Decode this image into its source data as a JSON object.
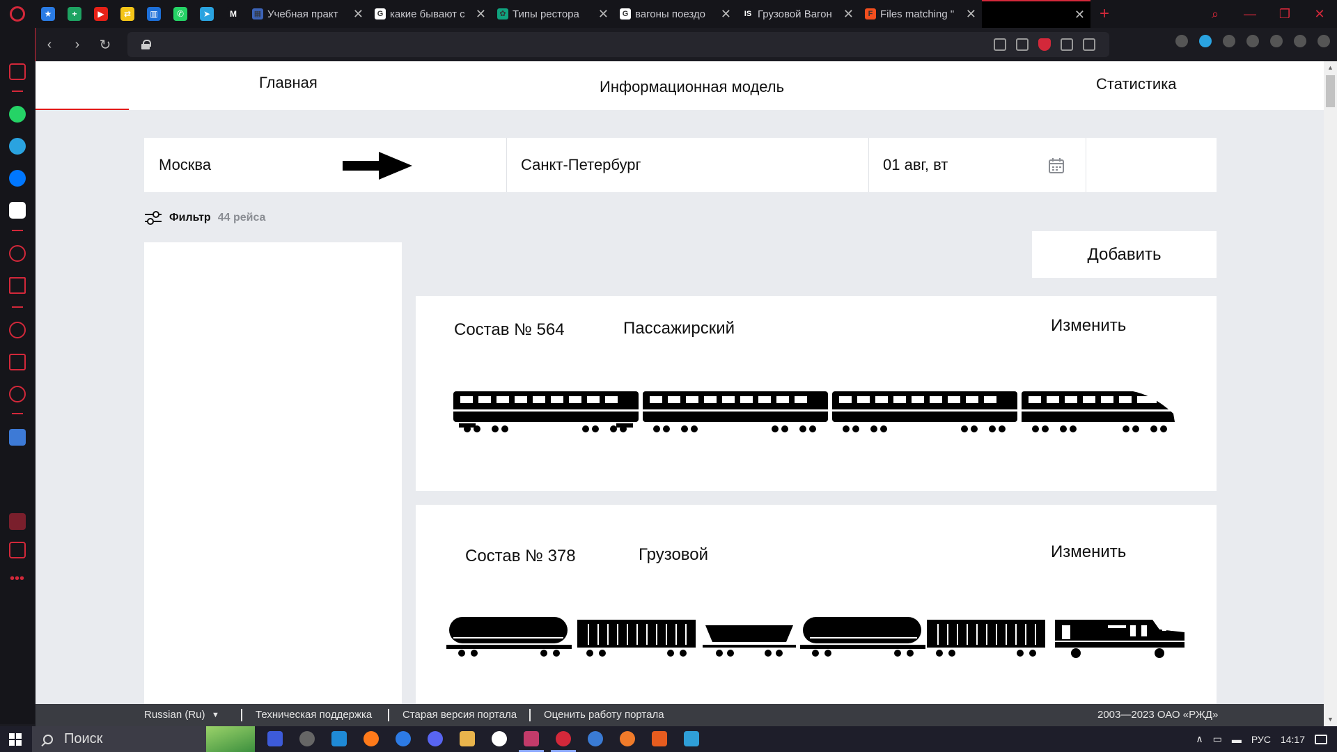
{
  "browser": {
    "tabs": [
      {
        "title": "Учебная практ",
        "favicon": "grid-icon",
        "color": "#3c63b7",
        "letter": "▦"
      },
      {
        "title": "какие бывают с",
        "favicon": "google-icon",
        "color": "#ffffff",
        "letter": "G"
      },
      {
        "title": "Типы рестора",
        "favicon": "chatgpt-icon",
        "color": "#10a37f",
        "letter": "✿"
      },
      {
        "title": "вагоны поездо",
        "favicon": "google-icon",
        "color": "#ffffff",
        "letter": "G"
      },
      {
        "title": "Грузовой Вагон",
        "favicon": "is-icon",
        "color": "#15151a",
        "letter": "IS"
      },
      {
        "title": "Files matching \"",
        "favicon": "figma-icon",
        "color": "#f24e1e",
        "letter": "F"
      },
      {
        "title": "",
        "favicon": "",
        "color": "#000000",
        "letter": ""
      }
    ],
    "pinned": [
      {
        "name": "aliexpress-icon",
        "color": "#2a7be4",
        "glyph": "★"
      },
      {
        "name": "sheets-icon",
        "color": "#1ea362",
        "glyph": "+"
      },
      {
        "name": "youtube-icon",
        "color": "#e62117",
        "glyph": "▶"
      },
      {
        "name": "swap-icon",
        "color": "#f5c518",
        "glyph": "⇄"
      },
      {
        "name": "trello-icon",
        "color": "#1d6fd8",
        "glyph": "▥"
      },
      {
        "name": "whatsapp-icon",
        "color": "#25d366",
        "glyph": "✆"
      },
      {
        "name": "telegram-icon",
        "color": "#2aa3e0",
        "glyph": "➤"
      },
      {
        "name": "gmail-icon",
        "color": "#15151a",
        "glyph": "M"
      }
    ]
  },
  "nav": {
    "home": "Главная",
    "model": "Информационная модель",
    "stats": "Статистика"
  },
  "route": {
    "from": "Москва",
    "to": "Санкт-Петербург",
    "date": "01 авг, вт"
  },
  "filter": {
    "label": "Фильтр",
    "count": "44 рейса"
  },
  "add_button": "Добавить",
  "trains": [
    {
      "number": "Состав № 564",
      "type": "Пассажирский",
      "edit": "Изменить"
    },
    {
      "number": "Состав № 378",
      "type": "Грузовой",
      "edit": "Изменить"
    }
  ],
  "footer": {
    "language": "Russian  (Ru)",
    "support": "Техническая поддержка",
    "old_version": "Старая версия портала",
    "rate": "Оценить работу портала",
    "copyright": "2003—2023 ОАО «РЖД»"
  },
  "taskbar": {
    "search": "Поиск",
    "lang": "РУС",
    "time": "14:17"
  },
  "colors": {
    "accent": "#d3283a",
    "rzd_red": "#e21a1a",
    "page_bg": "#e9ebef"
  }
}
